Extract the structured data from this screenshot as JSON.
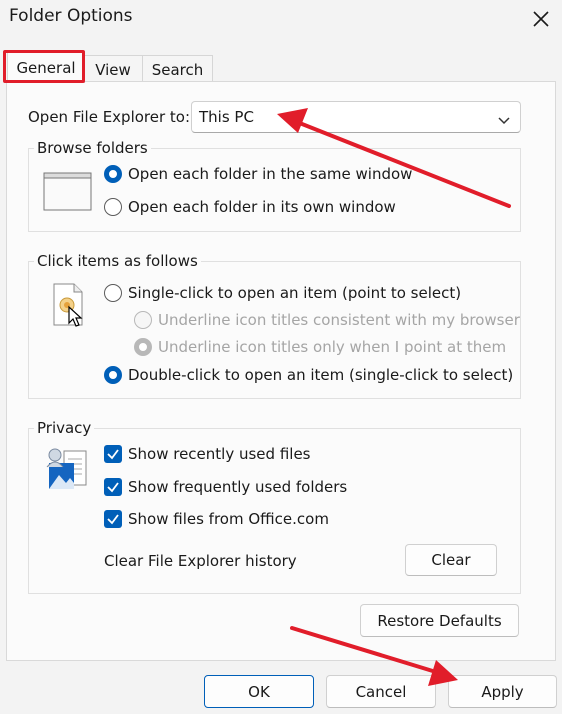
{
  "window": {
    "title": "Folder Options"
  },
  "tabs": [
    {
      "label": "General",
      "active": true
    },
    {
      "label": "View"
    },
    {
      "label": "Search"
    }
  ],
  "open_explorer": {
    "label": "Open File Explorer to:",
    "value": "This PC"
  },
  "browse_folders": {
    "title": "Browse folders",
    "options": [
      {
        "label": "Open each folder in the same window",
        "checked": true
      },
      {
        "label": "Open each folder in its own window",
        "checked": false
      }
    ]
  },
  "click_items": {
    "title": "Click items as follows",
    "single_click": {
      "label": "Single-click to open an item (point to select)",
      "checked": false
    },
    "underline_browser": {
      "label": "Underline icon titles consistent with my browser",
      "disabled": true
    },
    "underline_point": {
      "label": "Underline icon titles only when I point at them",
      "disabled": true,
      "checked": true
    },
    "double_click": {
      "label": "Double-click to open an item (single-click to select)",
      "checked": true
    }
  },
  "privacy": {
    "title": "Privacy",
    "checkboxes": [
      {
        "label": "Show recently used files",
        "checked": true
      },
      {
        "label": "Show frequently used folders",
        "checked": true
      },
      {
        "label": "Show files from Office.com",
        "checked": true
      }
    ],
    "clear_history_label": "Clear File Explorer history",
    "clear_button": "Clear"
  },
  "restore_defaults": "Restore Defaults",
  "buttons": {
    "ok": "OK",
    "cancel": "Cancel",
    "apply": "Apply"
  },
  "colors": {
    "accent": "#005fb8",
    "annotation_red": "#e11d2a"
  }
}
